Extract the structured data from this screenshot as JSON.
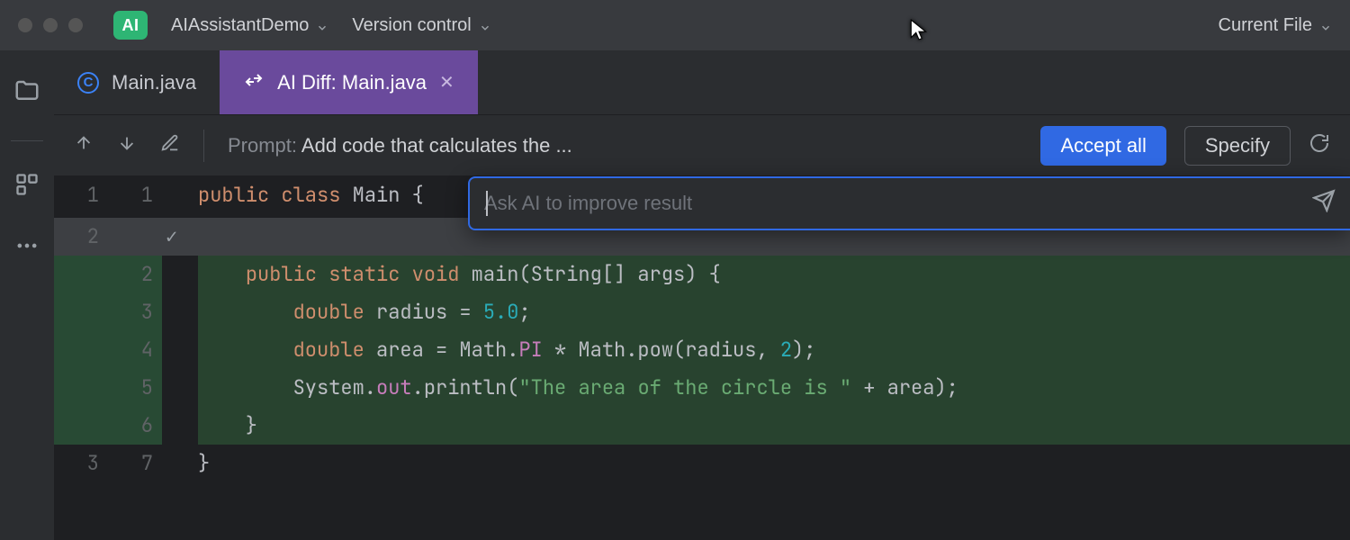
{
  "topbar": {
    "ai_badge": "AI",
    "project_name": "AIAssistantDemo",
    "vcs_label": "Version control",
    "run_scope": "Current File"
  },
  "tabs": {
    "main": {
      "label": "Main.java"
    },
    "diff": {
      "label": "AI Diff: Main.java"
    }
  },
  "toolbar": {
    "prompt_prefix": "Prompt: ",
    "prompt_text": "Add code that calculates the ...",
    "accept_all": "Accept all",
    "specify": "Specify"
  },
  "ai_popup": {
    "placeholder": "Ask AI to improve result"
  },
  "code": {
    "rows": [
      {
        "a": "1",
        "b": "1",
        "added": false,
        "mark": false
      },
      {
        "a": "2",
        "b": "",
        "added": false,
        "mark": true
      },
      {
        "a": "",
        "b": "2",
        "added": true,
        "mark": false
      },
      {
        "a": "",
        "b": "3",
        "added": true,
        "mark": false
      },
      {
        "a": "",
        "b": "4",
        "added": true,
        "mark": false
      },
      {
        "a": "",
        "b": "5",
        "added": true,
        "mark": false
      },
      {
        "a": "",
        "b": "6",
        "added": true,
        "mark": false
      },
      {
        "a": "3",
        "b": "7",
        "added": false,
        "mark": false
      }
    ],
    "line1_kw1": "public",
    "line1_kw2": "class",
    "line1_cls": "Main",
    "line1_close": " {",
    "line3_kw": "public static void",
    "line3_sig": " main(String[] args) {",
    "line4_kw": "double",
    "line4_rest": " radius = ",
    "line4_num": "5.0",
    "line4_semi": ";",
    "line5_kw": "double",
    "line5_rest_a": " area = Math.",
    "line5_pi": "PI",
    "line5_rest_b": " * Math.pow(radius, ",
    "line5_two": "2",
    "line5_rest_c": ");",
    "line6_sys": "System.",
    "line6_out": "out",
    "line6_rest_a": ".println(",
    "line6_str": "\"The area of the circle is \"",
    "line6_rest_b": " + area);",
    "line7": "    }",
    "line8": "}"
  }
}
